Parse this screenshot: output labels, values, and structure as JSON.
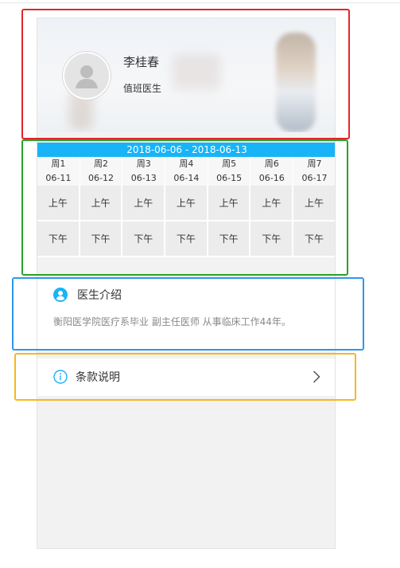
{
  "doctor": {
    "name": "李桂春",
    "title": "值班医生"
  },
  "schedule": {
    "range": "2018-06-06 - 2018-06-13",
    "days": [
      {
        "weekday": "周1",
        "date": "06-11"
      },
      {
        "weekday": "周2",
        "date": "06-12"
      },
      {
        "weekday": "周3",
        "date": "06-13"
      },
      {
        "weekday": "周4",
        "date": "06-14"
      },
      {
        "weekday": "周5",
        "date": "06-15"
      },
      {
        "weekday": "周6",
        "date": "06-16"
      },
      {
        "weekday": "周7",
        "date": "06-17"
      }
    ],
    "morning": [
      "上午",
      "上午",
      "上午",
      "上午",
      "上午",
      "上午",
      "上午"
    ],
    "afternoon": [
      "下午",
      "下午",
      "下午",
      "下午",
      "下午",
      "下午",
      "下午"
    ],
    "header_color": "#18b4f7"
  },
  "intro": {
    "label": "医生介绍",
    "text": "衡阳医学院医疗系毕业 副主任医师 从事临床工作44年。",
    "icon": "user-circle-icon"
  },
  "terms": {
    "label": "条款说明",
    "icon": "info-circle-icon"
  },
  "colors": {
    "accent": "#18b4f7",
    "box_red": "#e0262a",
    "box_green": "#2aa12a",
    "box_blue": "#2e96f0",
    "box_yellow": "#f5b81c"
  }
}
